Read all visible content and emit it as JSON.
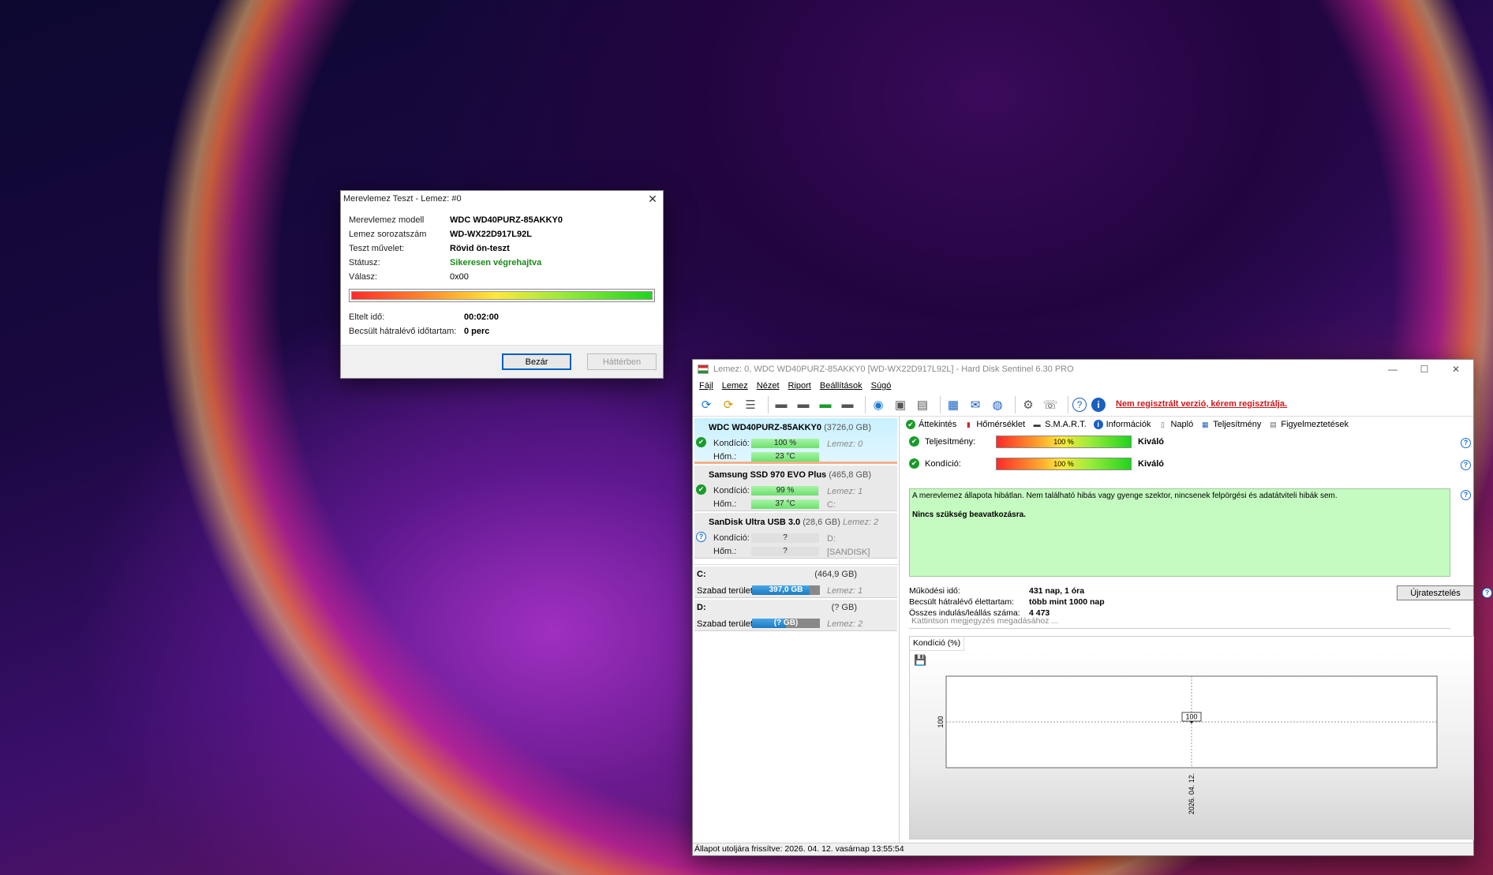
{
  "dialog": {
    "title": "Merevlemez Teszt - Lemez: #0",
    "close": "✕",
    "rows": [
      {
        "k": "Merevlemez modell",
        "v": "WDC WD40PURZ-85AKKY0"
      },
      {
        "k": "Lemez sorozatszám",
        "v": "WD-WX22D917L92L"
      },
      {
        "k": "Teszt művelet:",
        "v": "Rövid ön-teszt"
      },
      {
        "k": "Státusz:",
        "v": "Sikeresen végrehajtva"
      },
      {
        "k": "Válasz:",
        "v": "0x00"
      }
    ],
    "progress": 1.0,
    "elapsed_label": "Eltelt idő:",
    "elapsed_value": "00:02:00",
    "remaining_label": "Becsült hátralévő időtartam:",
    "remaining_value": "0 perc",
    "close_button": "Bezár",
    "background_button": "Háttérben"
  },
  "main": {
    "title": "Lemez: 0, WDC WD40PURZ-85AKKY0 [WD-WX22D917L92L]  -  Hard Disk Sentinel 6.30 PRO",
    "controls": {
      "minimize": "—",
      "maximize": "☐",
      "close": "✕"
    },
    "menu": [
      "Fájl",
      "Lemez",
      "Nézet",
      "Riport",
      "Beállítások",
      "Súgó"
    ],
    "unregistered": "Nem regisztrált verzió, kérem regisztrálja.",
    "disks": [
      {
        "name": "WDC WD40PURZ-85AKKY0",
        "size": "(3726,0 GB)",
        "cond_label": "Kondíció:",
        "cond": "100 %",
        "cond_fill": 1.0,
        "side1": "Lemez: 0",
        "temp_label": "Hőm.:",
        "temp": "23 °C",
        "temp_fill": 1.0,
        "side2": ""
      },
      {
        "name": "Samsung SSD 970 EVO Plus",
        "size": "(465,8 GB)",
        "cond_label": "Kondíció:",
        "cond": "99 %",
        "cond_fill": 0.99,
        "side1": "Lemez: 1",
        "temp_label": "Hőm.:",
        "temp": "37 °C",
        "temp_fill": 1.0,
        "side2": "C:"
      },
      {
        "name": "SanDisk Ultra USB 3.0",
        "size": "(28,6 GB)",
        "extra": "Lemez: 2",
        "cond_label": "Kondíció:",
        "cond": "?",
        "cond_fill": 0,
        "side1": "D:",
        "temp_label": "Hőm.:",
        "temp": "?",
        "temp_fill": 0,
        "side2": "[SANDISK]"
      }
    ],
    "partitions": [
      {
        "letter": "C:",
        "size": "(464,9 GB)",
        "free_label": "Szabad terület",
        "free": "397,0 GB",
        "free_fill": 0.85,
        "disk": "Lemez: 1"
      },
      {
        "letter": "D:",
        "size": "(? GB)",
        "free_label": "Szabad terület",
        "free": "(? GB)",
        "free_fill": 0.5,
        "disk": "Lemez: 2"
      }
    ],
    "tabs": [
      "Áttekintés",
      "Hőmérséklet",
      "S.M.A.R.T.",
      "Információk",
      "Napló",
      "Teljesítmény",
      "Figyelmeztetések"
    ],
    "performance_label": "Teljesítmény:",
    "performance_value": "100 %",
    "performance_text": "Kiváló",
    "condition_label": "Kondíció:",
    "condition_value": "100 %",
    "condition_text": "Kiváló",
    "status_text1": "A merevlemez állapota hibátlan. Nem található hibás vagy gyenge szektor, nincsenek felpörgési és adatátviteli hibák sem.",
    "status_text2": "Nincs szükség beavatkozásra.",
    "info": [
      {
        "k": "Működési idő:",
        "v": "431 nap, 1 óra"
      },
      {
        "k": "Becsült hátralévő élettartam:",
        "v": "több mint 1000 nap"
      },
      {
        "k": "Összes indulás/leállás száma:",
        "v": "4 473"
      }
    ],
    "retest_button": "Újratesztelés",
    "note_placeholder": "Kattintson megjegyzés megadásához ...",
    "chart_tab": "Kondíció  (%)",
    "statusbar": "Állapot utoljára frissítve: 2026. 04. 12. vasárnap 13:55:54"
  },
  "chart_data": {
    "type": "line",
    "x": [
      "2026. 04. 12."
    ],
    "values": [
      100
    ],
    "ylabel": "100",
    "data_label": "100"
  }
}
